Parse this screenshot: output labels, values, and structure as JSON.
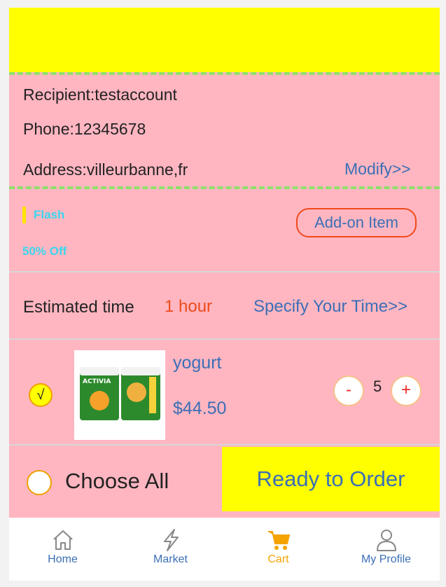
{
  "recipient": {
    "label": "Recipient:",
    "value": "testaccount"
  },
  "phone": {
    "label": "Phone:",
    "value": "12345678"
  },
  "address": {
    "label": "Address:",
    "value": "villeurbanne,fr",
    "modify_link": "Modify>>"
  },
  "promo": {
    "tag": "Flash",
    "discount": "50% Off",
    "addon_button": "Add-on Item"
  },
  "delivery": {
    "label": "Estimated time",
    "value": "1 hour",
    "specify_link": "Specify Your Time>>"
  },
  "cart_item": {
    "checked_mark": "√",
    "name": "yogurt",
    "price": "$44.50",
    "quantity": "5",
    "minus": "-",
    "plus": "+",
    "image_brand": "ACTIVIA"
  },
  "footer": {
    "choose_all": "Choose All",
    "order_button": "Ready to Order"
  },
  "tabs": [
    {
      "label": "Home",
      "icon": "home-icon"
    },
    {
      "label": "Market",
      "icon": "lightning-icon"
    },
    {
      "label": "Cart",
      "icon": "cart-icon",
      "active": true
    },
    {
      "label": "My Profile",
      "icon": "profile-icon"
    }
  ],
  "colors": {
    "background": "#ffb6c1",
    "header": "#ffff00",
    "dashed_divider": "#8fe06c",
    "accent_orange": "#f04a1a",
    "link_blue": "#3b6fb6",
    "active_tab": "#f5a300"
  }
}
